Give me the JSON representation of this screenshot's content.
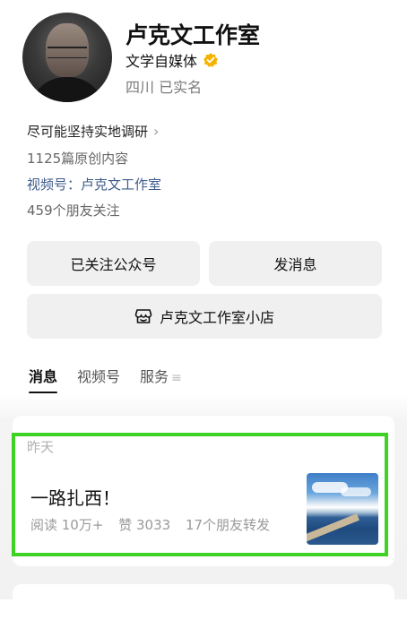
{
  "profile": {
    "name": "卢克文工作室",
    "type": "文学自媒体",
    "location": "四川 已实名",
    "description": "尽可能坚持实地调研",
    "original_count": "1125篇原创内容",
    "channel": "视频号：卢克文工作室",
    "friends_following": "459个朋友关注",
    "verified_icon": "verified-badge-icon",
    "verified_color": "#f5b300"
  },
  "buttons": {
    "follow": "已关注公众号",
    "message": "发消息",
    "shop": "卢克文工作室小店"
  },
  "tabs": [
    {
      "label": "消息",
      "active": true
    },
    {
      "label": "视频号",
      "active": false
    },
    {
      "label": "服务",
      "active": false
    }
  ],
  "feed": {
    "date": "昨天",
    "article": {
      "title": "一路扎西！",
      "reads": "阅读 10万+",
      "likes": "赞 3033",
      "shares": "17个朋友转发"
    }
  },
  "colors": {
    "highlight": "#3ed224",
    "link": "#3d5a8a"
  }
}
